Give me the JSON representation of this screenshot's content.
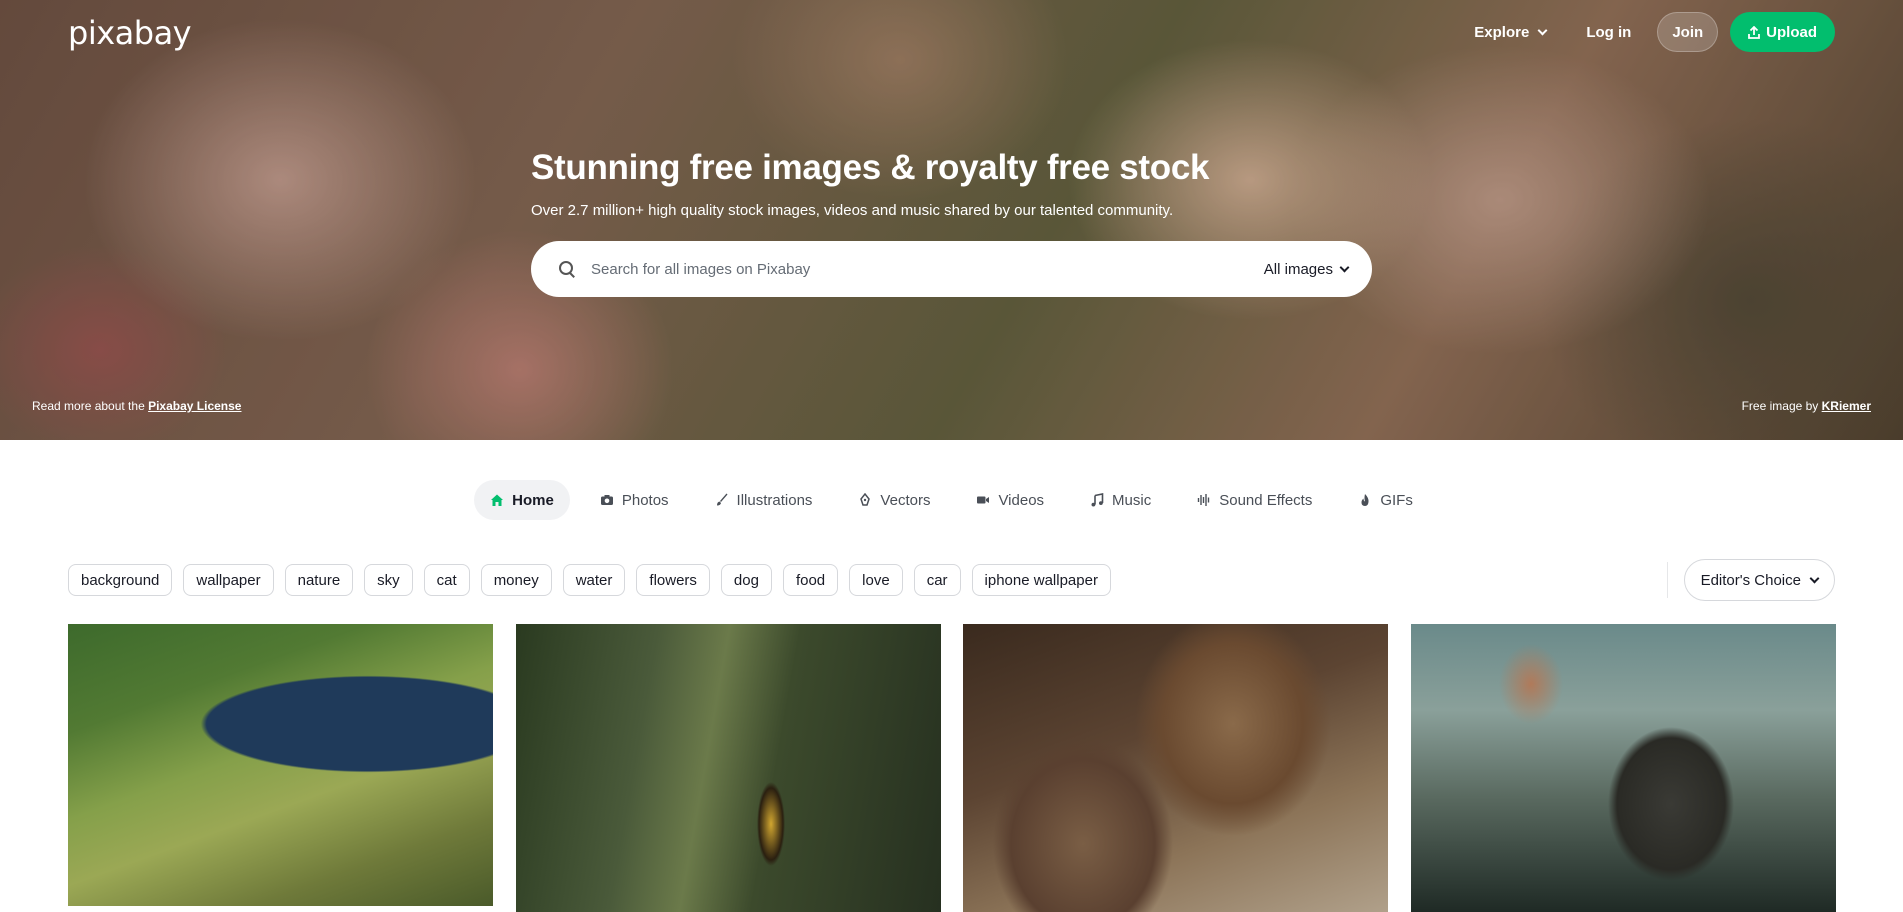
{
  "brand": {
    "logo_text": "pixabay"
  },
  "nav": {
    "explore": "Explore",
    "login": "Log in",
    "join": "Join",
    "upload": "Upload"
  },
  "hero": {
    "title": "Stunning free images & royalty free stock",
    "subtitle": "Over 2.7 million+ high quality stock images, videos and music shared by our talented community.",
    "search": {
      "placeholder": "Search for all images on Pixabay",
      "type_label": "All images"
    },
    "license_prefix": "Read more about the",
    "license_link": "Pixabay License",
    "credit_prefix": "Free image by",
    "credit_author": "KRiemer"
  },
  "tabs": [
    {
      "label": "Home",
      "icon": "home-icon",
      "active": true
    },
    {
      "label": "Photos",
      "icon": "camera-icon"
    },
    {
      "label": "Illustrations",
      "icon": "brush-icon"
    },
    {
      "label": "Vectors",
      "icon": "pen-nib-icon"
    },
    {
      "label": "Videos",
      "icon": "video-icon"
    },
    {
      "label": "Music",
      "icon": "music-icon"
    },
    {
      "label": "Sound Effects",
      "icon": "waveform-icon"
    },
    {
      "label": "GIFs",
      "icon": "flame-icon"
    }
  ],
  "tags": [
    "background",
    "wallpaper",
    "nature",
    "sky",
    "cat",
    "money",
    "water",
    "flowers",
    "dog",
    "food",
    "love",
    "car",
    "iphone wallpaper"
  ],
  "sort": {
    "label": "Editor's Choice"
  },
  "colors": {
    "accent": "#02be6e",
    "text": "#191b26",
    "muted": "#4a4f57"
  }
}
